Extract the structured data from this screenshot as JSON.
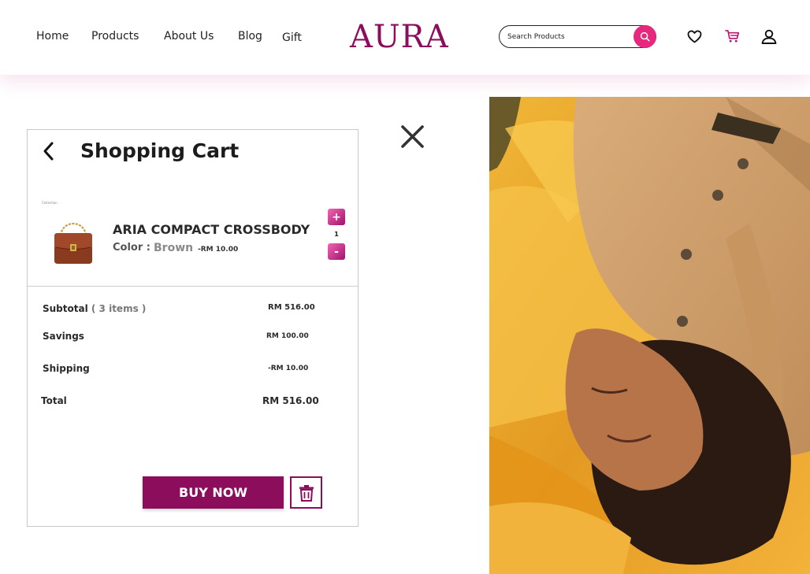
{
  "header": {
    "nav": [
      "Home",
      "Products",
      "About Us",
      "Blog",
      "Gift"
    ],
    "logo": "AURA",
    "search_placeholder": "Search Products",
    "icons": [
      "heart-icon",
      "cart-icon",
      "user-icon"
    ]
  },
  "cart": {
    "title": "Shopping Cart",
    "caption": "Collection",
    "item": {
      "name": "ARIA COMPACT CROSSBODY",
      "color_label": "Color :",
      "color_value": "Brown",
      "price": "-RM 10.00",
      "quantity": "1",
      "plus": "+",
      "minus": "-"
    },
    "summary": {
      "subtotal_label": "Subtotal",
      "subtotal_items": "( 3 items )",
      "subtotal_value": "RM 516.00",
      "savings_label": "Savings",
      "savings_value": "RM 100.00",
      "shipping_label": "Shipping",
      "shipping_value": "-RM 10.00",
      "total_label": "Total",
      "total_value": "RM 516.00"
    },
    "buy_label": "BUY NOW"
  },
  "colors": {
    "brand": "#8c0d5c",
    "accent": "#e6287e",
    "photo_background": "#e7a82c"
  }
}
